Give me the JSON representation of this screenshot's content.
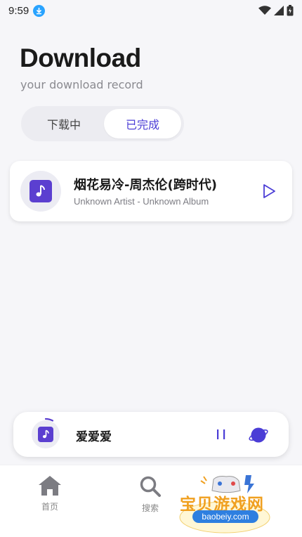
{
  "status_bar": {
    "time": "9:59"
  },
  "header": {
    "title": "Download",
    "subtitle": "your download record"
  },
  "tabs": [
    {
      "label": "下载中",
      "selected": false
    },
    {
      "label": "已完成",
      "selected": true
    }
  ],
  "downloads": [
    {
      "title": "烟花易冷-周杰伦(跨时代)",
      "meta": "Unknown Artist - Unknown Album"
    }
  ],
  "mini_player": {
    "title": "爱爱爱",
    "state": "playing"
  },
  "bottom_nav": [
    {
      "label": "首页",
      "icon": "home-icon"
    },
    {
      "label": "搜索",
      "icon": "search-icon"
    }
  ],
  "watermark": {
    "text": "宝贝游戏网",
    "url": "baobeiy.com"
  },
  "colors": {
    "accent": "#4b3dd6",
    "cover": "#5b3fd0",
    "background": "#f6f6f9"
  }
}
